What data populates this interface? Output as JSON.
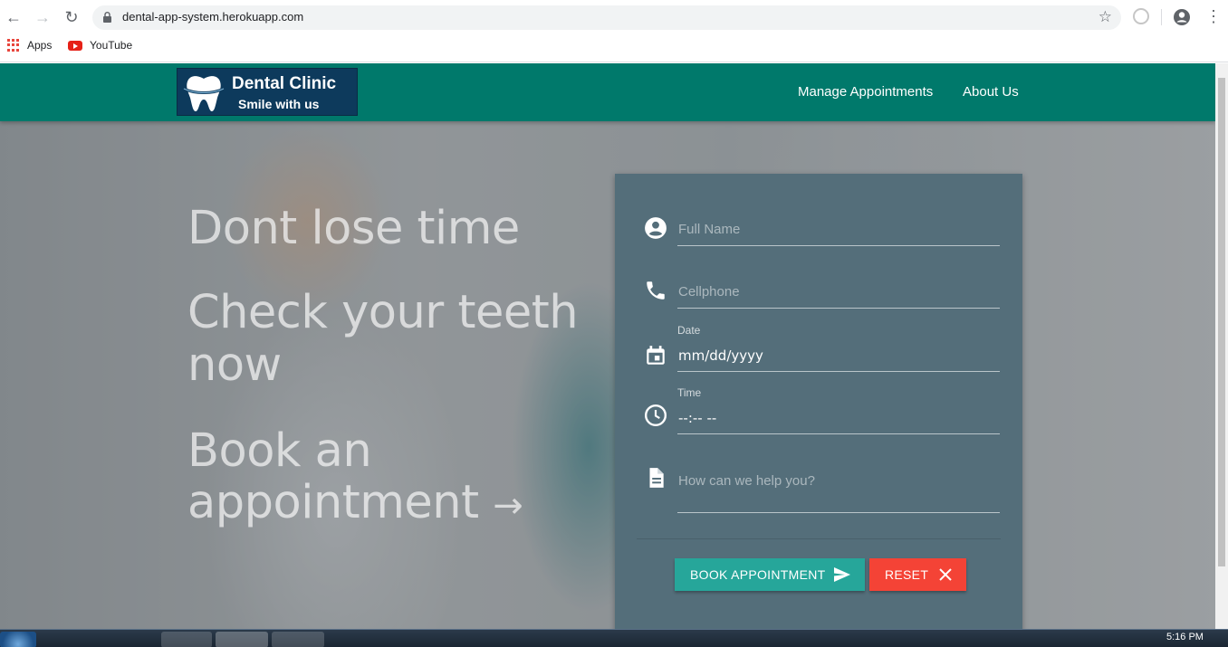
{
  "browser": {
    "url": "dental-app-system.herokuapp.com",
    "bookmarks": [
      {
        "label": "Apps"
      },
      {
        "label": "YouTube"
      }
    ]
  },
  "site": {
    "logo": {
      "title": "Dental Clinic",
      "subtitle": "Smile with us"
    },
    "nav": [
      {
        "label": "Manage Appointments"
      },
      {
        "label": "About Us"
      }
    ],
    "headlines": [
      "Dont lose time",
      "Check your teeth",
      "now",
      "Book an",
      "appointment"
    ],
    "headline_arrow": "→"
  },
  "form": {
    "full_name_placeholder": "Full Name",
    "cellphone_placeholder": "Cellphone",
    "date_label": "Date",
    "date_value": "mm/dd/yyyy",
    "time_label": "Time",
    "time_value": "--:-- --",
    "message_placeholder": "How can we help you?",
    "book_label": "BOOK APPOINTMENT",
    "reset_label": "RESET"
  },
  "taskbar": {
    "clock": "5:16 PM"
  },
  "colors": {
    "navbar": "#00796b",
    "card": "#546e7a",
    "book_button": "#26a69a",
    "reset_button": "#f44336"
  }
}
